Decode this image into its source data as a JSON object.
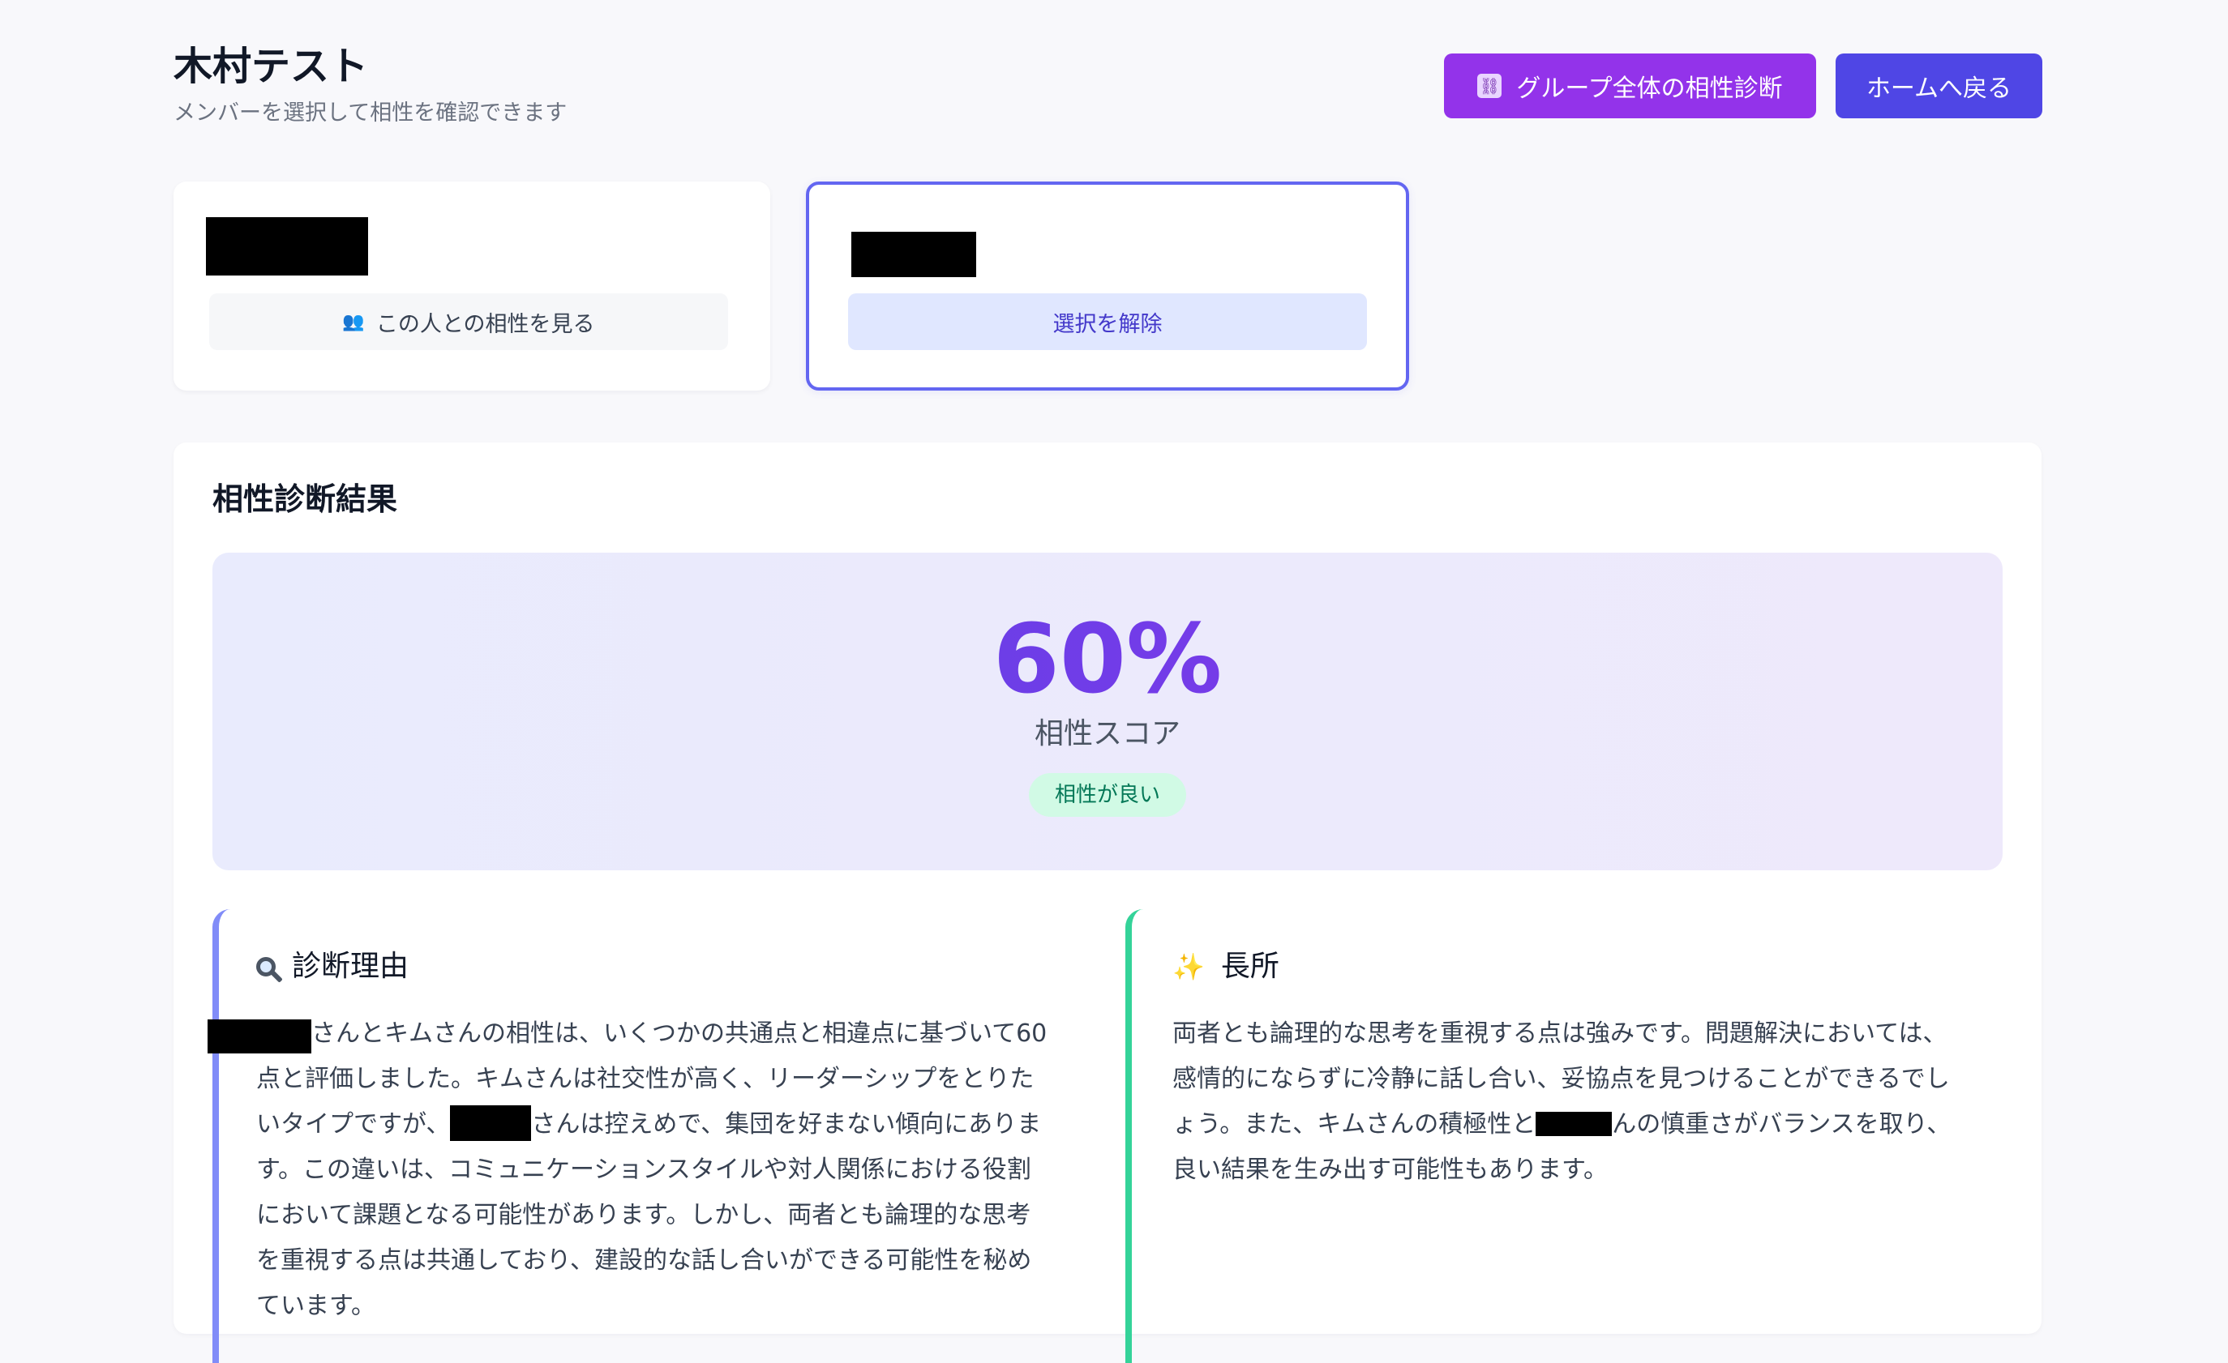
{
  "header": {
    "title": "木村テスト",
    "subtitle": "メンバーを選択して相性を確認できます",
    "group_button_label": "グループ全体の相性診断",
    "group_button_icon": "group-icon",
    "home_button_label": "ホームへ戻る"
  },
  "members": [
    {
      "action_label": "この人との相性を見る",
      "action_icon": "people-icon",
      "selected": false
    },
    {
      "action_label": "選択を解除",
      "selected": true
    }
  ],
  "result": {
    "title": "相性診断結果",
    "score": "60%",
    "score_label": "相性スコア",
    "badge": "相性が良い",
    "reason": {
      "heading": "診断理由",
      "icon": "magnifier-icon",
      "text_1": "さんとキムさんの相性は、いくつかの共通点と相違点に基づいて60点と評価しました。キムさんは社交性が高く、リーダーシップをとりたいタイプですが、",
      "text_2": "さんは控えめで、集団を好まない傾向にあります。この違いは、コミュニケーションスタイルや対人関係における役割において課題となる可能性があります。しかし、両者とも論理的な思考を重視する点は共通しており、建設的な話し合いができる可能性を秘めています。"
    },
    "strengths": {
      "heading": "長所",
      "icon": "sparkles-icon",
      "text_1": "両者とも論理的な思考を重視する点は強みです。問題解決においては、感情的にならずに冷静に話し合い、妥協点を見つけることができるでしょう。また、キムさんの積極性と",
      "text_2": "んの慎重さがバランスを取り、良い結果を生み出す可能性もあります。"
    }
  },
  "colors": {
    "accent_purple": "#9333ea",
    "accent_indigo": "#4f46e5",
    "badge_green": "#d1fae5",
    "reason_border": "#818cf8",
    "strength_border": "#34d399"
  }
}
